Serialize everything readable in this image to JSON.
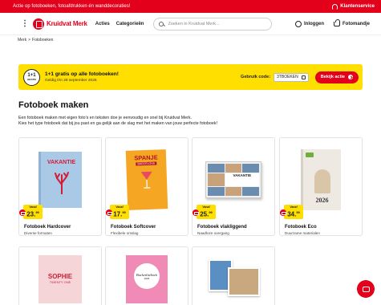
{
  "topbar": {
    "promo_text": "Actie op fotoboeken, fotoafdrukken én wanddecoraties!",
    "service_label": "Klantenservice"
  },
  "header": {
    "logo_text": "Kruidvat Merk",
    "nav": [
      "Acties",
      "Categorieën"
    ],
    "search_placeholder": "Zoeken in Kruidvat Merk...",
    "login_label": "Inloggen",
    "basket_label": "Fotomandje"
  },
  "breadcrumb": [
    "Merk",
    ">",
    "Fotoboeken"
  ],
  "promo": {
    "badge_big": "1+1",
    "badge_small": "GRATIS",
    "title": "1+1 gratis op alle fotoboeken!",
    "subtitle": "Geldig t/m 28 september 2026",
    "code_label": "Gebruik code:",
    "code": "3TBOEKEN",
    "button_label": "Bekijk actie"
  },
  "page": {
    "title": "Fotoboek maken",
    "intro_1": "Een fotoboek maken met eigen foto's en teksten doe je eenvoudig en snel bij Kruidvat Merk.",
    "intro_2": "Kies het type fotoboek dat bij jou past en ga gelijk aan de slag met het maken van jouw perfecte fotoboek!"
  },
  "products": [
    {
      "name": "Fotoboek Hardcover",
      "desc": "Diverse formaten",
      "vanaf": "Vanaf",
      "price_main": "23.",
      "price_cents": "99",
      "cover_title": "VAKANTIE"
    },
    {
      "name": "Fotoboek Softcover",
      "desc": "Flexibele omslag",
      "vanaf": "Vanaf",
      "price_main": "17.",
      "price_cents": "99",
      "cover_title": "SPANJE",
      "cover_sub": "BARCELONA"
    },
    {
      "name": "Fotoboek vlakliggend",
      "desc": "Naadloze overgang",
      "vanaf": "Vanaf",
      "price_main": "25.",
      "price_cents": "99",
      "cover_title": "VAKANTIE"
    },
    {
      "name": "Fotoboek Eco",
      "desc": "Duurzame materialen",
      "vanaf": "Vanaf",
      "price_main": "34.",
      "price_cents": "99",
      "cover_title": "2026"
    },
    {
      "cover_title": "SOPHIE",
      "cover_sub": "TWENTY ONE"
    },
    {
      "cover_title": "Bucketlistboek",
      "cover_sub": "2026"
    },
    {}
  ],
  "colors": {
    "brand_red": "#e2001a",
    "promo_yellow": "#ffdf00"
  }
}
